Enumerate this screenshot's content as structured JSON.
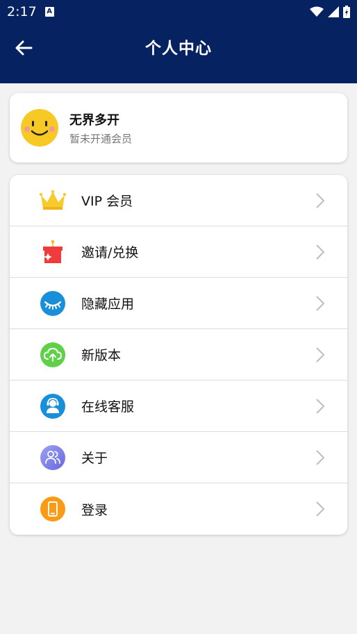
{
  "status_bar": {
    "time": "2:17"
  },
  "header": {
    "title": "个人中心"
  },
  "profile": {
    "name": "无界多开",
    "status": "暂未开通会员"
  },
  "menu": {
    "items": [
      {
        "label": "VIP 会员",
        "icon": "crown-icon"
      },
      {
        "label": "邀请/兑换",
        "icon": "gift-icon"
      },
      {
        "label": "隐藏应用",
        "icon": "closed-eye-icon"
      },
      {
        "label": "新版本",
        "icon": "cloud-upload-icon"
      },
      {
        "label": "在线客服",
        "icon": "customer-service-icon"
      },
      {
        "label": "关于",
        "icon": "people-icon"
      },
      {
        "label": "登录",
        "icon": "phone-icon"
      }
    ]
  },
  "colors": {
    "header_bg": "#062260",
    "page_bg": "#f2f2f2",
    "crown": "#f7cb2e",
    "gift": "#ef3b3b",
    "eye": "#1a8fd9",
    "cloud": "#5fd047",
    "service": "#1a8fd9",
    "about": "#7b7fe8",
    "login": "#fb9a14"
  }
}
